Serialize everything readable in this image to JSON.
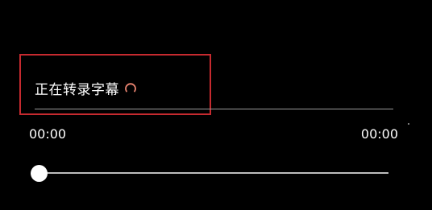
{
  "transcription": {
    "status_text": "正在转录字幕",
    "loading_icon": "spinner-icon",
    "spinner_color": "#e8836f",
    "highlight_color": "#c62a2f"
  },
  "player": {
    "current_time": "00:00",
    "total_time": "00:00",
    "progress": 0
  }
}
